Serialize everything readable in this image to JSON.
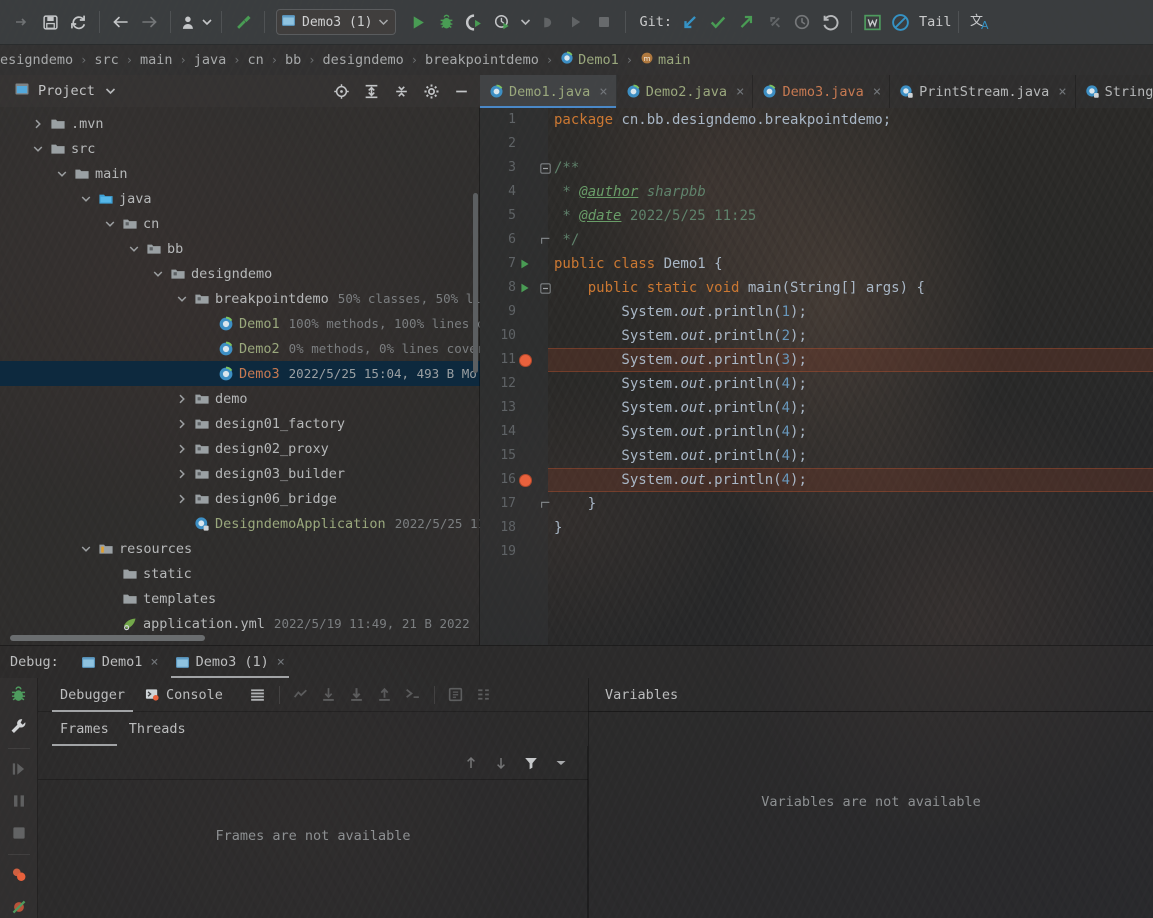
{
  "toolbar": {
    "icons_left": [
      {
        "name": "save-icon",
        "glyph": "save"
      },
      {
        "name": "sync-icon",
        "glyph": "sync"
      },
      {
        "name": "back-arrow-icon",
        "glyph": "back"
      },
      {
        "name": "forward-arrow-icon",
        "glyph": "forward"
      },
      {
        "name": "profile-icon",
        "glyph": "profile"
      },
      {
        "name": "build-hammer-icon",
        "glyph": "hammer"
      }
    ],
    "run_config": {
      "label": "Demo3 (1)",
      "icon": "run-config-icon"
    },
    "run_icons": [
      {
        "name": "run-button",
        "glyph": "run"
      },
      {
        "name": "debug-button",
        "glyph": "debug"
      },
      {
        "name": "run-with-coverage-button",
        "glyph": "coverage"
      },
      {
        "name": "profile-button",
        "glyph": "profiler"
      },
      {
        "name": "more-run-options-button",
        "glyph": "chevron"
      },
      {
        "name": "attach-process-button",
        "glyph": "attach"
      },
      {
        "name": "rerun-button",
        "glyph": "rerun-disabled"
      },
      {
        "name": "stop-button",
        "glyph": "stop"
      }
    ],
    "git_label": "Git:",
    "git_icons": [
      {
        "name": "git-update-project-icon",
        "glyph": "update"
      },
      {
        "name": "git-commit-icon",
        "glyph": "commit"
      },
      {
        "name": "git-push-icon",
        "glyph": "push"
      },
      {
        "name": "git-rollback-icon",
        "glyph": "rollback"
      },
      {
        "name": "git-history-icon",
        "glyph": "history"
      },
      {
        "name": "undo-icon",
        "glyph": "undo"
      }
    ],
    "right_icons": [
      {
        "name": "translate-w-icon",
        "glyph": "wbox"
      },
      {
        "name": "no-entry-icon",
        "glyph": "noentry"
      }
    ],
    "tail_label": "Tail",
    "translate_icon": "translate-icon"
  },
  "breadcrumb": {
    "items": [
      {
        "label": "esigndemo",
        "kind": "plain"
      },
      {
        "label": "src",
        "kind": "plain"
      },
      {
        "label": "main",
        "kind": "plain"
      },
      {
        "label": "java",
        "kind": "plain"
      },
      {
        "label": "cn",
        "kind": "plain"
      },
      {
        "label": "bb",
        "kind": "plain"
      },
      {
        "label": "designdemo",
        "kind": "plain"
      },
      {
        "label": "breakpointdemo",
        "kind": "plain"
      },
      {
        "label": "Demo1",
        "kind": "class"
      },
      {
        "label": "main",
        "kind": "method"
      }
    ],
    "separator": "›"
  },
  "project_panel": {
    "title": "Project",
    "title_icon": "project-view-icon",
    "dropdown_icon": "chevron-down-icon",
    "actions": [
      {
        "name": "locate-file-icon",
        "glyph": "target"
      },
      {
        "name": "expand-all-icon",
        "glyph": "expand"
      },
      {
        "name": "collapse-all-icon",
        "glyph": "collapse"
      },
      {
        "name": "settings-gear-icon",
        "glyph": "gear"
      },
      {
        "name": "hide-panel-icon",
        "glyph": "minus"
      }
    ],
    "tree": [
      {
        "label": ".mvn",
        "indent": 1,
        "twisty": "right",
        "icon": "folder",
        "info": "",
        "selected": false,
        "kind": "plain"
      },
      {
        "label": "src",
        "indent": 1,
        "twisty": "down",
        "icon": "folder",
        "info": "",
        "selected": false,
        "kind": "plain"
      },
      {
        "label": "main",
        "indent": 2,
        "twisty": "down",
        "icon": "folder",
        "info": "",
        "selected": false,
        "kind": "plain"
      },
      {
        "label": "java",
        "indent": 3,
        "twisty": "down",
        "icon": "folder-source",
        "info": "",
        "selected": false,
        "kind": "plain"
      },
      {
        "label": "cn",
        "indent": 4,
        "twisty": "down",
        "icon": "folder-pkg",
        "info": "",
        "selected": false,
        "kind": "plain"
      },
      {
        "label": "bb",
        "indent": 5,
        "twisty": "down",
        "icon": "folder-pkg",
        "info": "",
        "selected": false,
        "kind": "plain"
      },
      {
        "label": "designdemo",
        "indent": 6,
        "twisty": "down",
        "icon": "folder-pkg",
        "info": "",
        "selected": false,
        "kind": "plain"
      },
      {
        "label": "breakpointdemo",
        "indent": 7,
        "twisty": "down",
        "icon": "folder-pkg",
        "info": "50% classes, 50% li",
        "selected": false,
        "kind": "plain"
      },
      {
        "label": "Demo1",
        "indent": 8,
        "twisty": "none",
        "icon": "java-class",
        "info": "100% methods, 100% lines c",
        "selected": false,
        "kind": "green"
      },
      {
        "label": "Demo2",
        "indent": 8,
        "twisty": "none",
        "icon": "java-class",
        "info": "0% methods, 0% lines cover",
        "selected": false,
        "kind": "green"
      },
      {
        "label": "Demo3",
        "indent": 8,
        "twisty": "none",
        "icon": "java-class",
        "info": "2022/5/25 15:04, 493 B Mo",
        "selected": true,
        "kind": "selected"
      },
      {
        "label": "demo",
        "indent": 7,
        "twisty": "right",
        "icon": "folder-pkg",
        "info": "",
        "selected": false,
        "kind": "plain"
      },
      {
        "label": "design01_factory",
        "indent": 7,
        "twisty": "right",
        "icon": "folder-pkg",
        "info": "",
        "selected": false,
        "kind": "plain"
      },
      {
        "label": "design02_proxy",
        "indent": 7,
        "twisty": "right",
        "icon": "folder-pkg",
        "info": "",
        "selected": false,
        "kind": "plain"
      },
      {
        "label": "design03_builder",
        "indent": 7,
        "twisty": "right",
        "icon": "folder-pkg",
        "info": "",
        "selected": false,
        "kind": "plain"
      },
      {
        "label": "design06_bridge",
        "indent": 7,
        "twisty": "right",
        "icon": "folder-pkg",
        "info": "",
        "selected": false,
        "kind": "plain"
      },
      {
        "label": "DesigndemoApplication",
        "indent": 7,
        "twisty": "none",
        "icon": "spring-class",
        "info": "2022/5/25 11",
        "selected": false,
        "kind": "green"
      },
      {
        "label": "resources",
        "indent": 3,
        "twisty": "down",
        "icon": "folder-resources",
        "info": "",
        "selected": false,
        "kind": "plain"
      },
      {
        "label": "static",
        "indent": 4,
        "twisty": "none",
        "icon": "folder",
        "info": "",
        "selected": false,
        "kind": "plain"
      },
      {
        "label": "templates",
        "indent": 4,
        "twisty": "none",
        "icon": "folder",
        "info": "",
        "selected": false,
        "kind": "plain"
      },
      {
        "label": "application.yml",
        "indent": 4,
        "twisty": "none",
        "icon": "yml-file",
        "info": "2022/5/19 11:49, 21 B 2022",
        "selected": false,
        "kind": "plain"
      }
    ]
  },
  "editor_tabs": [
    {
      "label": "Demo1.java",
      "icon": "java-class-icon",
      "color": "#9aa87d",
      "active": true,
      "close": "×"
    },
    {
      "label": "Demo2.java",
      "icon": "java-class-icon",
      "color": "#9aa87d",
      "active": false,
      "close": "×"
    },
    {
      "label": "Demo3.java",
      "icon": "java-class-icon",
      "color": "#c77a52",
      "active": false,
      "close": "×"
    },
    {
      "label": "PrintStream.java",
      "icon": "java-class-readonly-icon",
      "color": "#b6b8b9",
      "active": false,
      "close": "×"
    },
    {
      "label": "String",
      "icon": "java-class-readonly-icon",
      "color": "#b6b8b9",
      "active": false,
      "close": ""
    }
  ],
  "editor": {
    "file": "Demo1.java",
    "lines": [
      {
        "n": 1,
        "mark": "none",
        "fold": "none",
        "bp": false,
        "tokens": [
          {
            "t": "package ",
            "c": "kw"
          },
          {
            "t": "cn.bb.designdemo.breakpointdemo;",
            "c": "txt"
          }
        ],
        "indent": 0
      },
      {
        "n": 2,
        "mark": "none",
        "fold": "none",
        "bp": false,
        "tokens": [],
        "indent": 0
      },
      {
        "n": 3,
        "mark": "none",
        "fold": "minus",
        "bp": false,
        "tokens": [
          {
            "t": "/**",
            "c": "cmt"
          }
        ],
        "indent": 0
      },
      {
        "n": 4,
        "mark": "none",
        "fold": "none",
        "bp": false,
        "tokens": [
          {
            "t": " * ",
            "c": "cmt"
          },
          {
            "t": "@author",
            "c": "tag"
          },
          {
            "t": " sharpbb",
            "c": "cmt-i"
          }
        ],
        "indent": 0
      },
      {
        "n": 5,
        "mark": "none",
        "fold": "none",
        "bp": false,
        "tokens": [
          {
            "t": " * ",
            "c": "cmt"
          },
          {
            "t": "@date",
            "c": "tag"
          },
          {
            "t": " 2022/5/25 11:25",
            "c": "cmt"
          }
        ],
        "indent": 0
      },
      {
        "n": 6,
        "mark": "none",
        "fold": "end",
        "bp": false,
        "tokens": [
          {
            "t": " */",
            "c": "cmt"
          }
        ],
        "indent": 0
      },
      {
        "n": 7,
        "mark": "run",
        "fold": "none",
        "bp": false,
        "tokens": [
          {
            "t": "public class ",
            "c": "kw"
          },
          {
            "t": "Demo1 {",
            "c": "cls"
          }
        ],
        "indent": 0
      },
      {
        "n": 8,
        "mark": "run",
        "fold": "minus",
        "bp": false,
        "tokens": [
          {
            "t": "    public static void ",
            "c": "kw"
          },
          {
            "t": "main(String[] args) {",
            "c": "cls"
          }
        ],
        "indent": 0
      },
      {
        "n": 9,
        "mark": "none",
        "fold": "none",
        "bp": false,
        "tokens": [
          {
            "t": "        System.",
            "c": "txt"
          },
          {
            "t": "out",
            "c": "fld"
          },
          {
            "t": ".println(",
            "c": "txt"
          },
          {
            "t": "1",
            "c": "num"
          },
          {
            "t": ");",
            "c": "txt"
          }
        ],
        "indent": 0
      },
      {
        "n": 10,
        "mark": "none",
        "fold": "none",
        "bp": false,
        "tokens": [
          {
            "t": "        System.",
            "c": "txt"
          },
          {
            "t": "out",
            "c": "fld"
          },
          {
            "t": ".println(",
            "c": "txt"
          },
          {
            "t": "2",
            "c": "num"
          },
          {
            "t": ");",
            "c": "txt"
          }
        ],
        "indent": 0
      },
      {
        "n": 11,
        "mark": "breakpoint",
        "fold": "none",
        "bp": true,
        "tokens": [
          {
            "t": "        System.",
            "c": "txt"
          },
          {
            "t": "out",
            "c": "fld"
          },
          {
            "t": ".println(",
            "c": "txt"
          },
          {
            "t": "3",
            "c": "num"
          },
          {
            "t": ");",
            "c": "txt"
          }
        ],
        "indent": 0
      },
      {
        "n": 12,
        "mark": "none",
        "fold": "none",
        "bp": false,
        "tokens": [
          {
            "t": "        System.",
            "c": "txt"
          },
          {
            "t": "out",
            "c": "fld"
          },
          {
            "t": ".println(",
            "c": "txt"
          },
          {
            "t": "4",
            "c": "num"
          },
          {
            "t": ");",
            "c": "txt"
          }
        ],
        "indent": 0
      },
      {
        "n": 13,
        "mark": "none",
        "fold": "none",
        "bp": false,
        "tokens": [
          {
            "t": "        System.",
            "c": "txt"
          },
          {
            "t": "out",
            "c": "fld"
          },
          {
            "t": ".println(",
            "c": "txt"
          },
          {
            "t": "4",
            "c": "num"
          },
          {
            "t": ");",
            "c": "txt"
          }
        ],
        "indent": 0
      },
      {
        "n": 14,
        "mark": "none",
        "fold": "none",
        "bp": false,
        "tokens": [
          {
            "t": "        System.",
            "c": "txt"
          },
          {
            "t": "out",
            "c": "fld"
          },
          {
            "t": ".println(",
            "c": "txt"
          },
          {
            "t": "4",
            "c": "num"
          },
          {
            "t": ");",
            "c": "txt"
          }
        ],
        "indent": 0
      },
      {
        "n": 15,
        "mark": "none",
        "fold": "none",
        "bp": false,
        "tokens": [
          {
            "t": "        System.",
            "c": "txt"
          },
          {
            "t": "out",
            "c": "fld"
          },
          {
            "t": ".println(",
            "c": "txt"
          },
          {
            "t": "4",
            "c": "num"
          },
          {
            "t": ");",
            "c": "txt"
          }
        ],
        "indent": 0
      },
      {
        "n": 16,
        "mark": "breakpoint",
        "fold": "none",
        "bp": true,
        "tokens": [
          {
            "t": "        System.",
            "c": "txt"
          },
          {
            "t": "out",
            "c": "fld"
          },
          {
            "t": ".println(",
            "c": "txt"
          },
          {
            "t": "4",
            "c": "num"
          },
          {
            "t": ");",
            "c": "txt"
          }
        ],
        "indent": 0
      },
      {
        "n": 17,
        "mark": "none",
        "fold": "end",
        "bp": false,
        "tokens": [
          {
            "t": "    }",
            "c": "txt"
          }
        ],
        "indent": 0
      },
      {
        "n": 18,
        "mark": "none",
        "fold": "none",
        "bp": false,
        "tokens": [
          {
            "t": "}",
            "c": "txt"
          }
        ],
        "indent": 0
      },
      {
        "n": 19,
        "mark": "none",
        "fold": "none",
        "bp": false,
        "tokens": [],
        "indent": 0
      }
    ]
  },
  "debug": {
    "label": "Debug:",
    "sessions": [
      {
        "label": "Demo1",
        "active": false,
        "close": "×",
        "icon": "session-icon"
      },
      {
        "label": "Demo3 (1)",
        "active": true,
        "close": "×",
        "icon": "session-icon"
      }
    ],
    "rail": [
      {
        "name": "debugger-bug-icon",
        "glyph": "bug"
      },
      {
        "name": "settings-wrench-icon",
        "glyph": "wrench"
      },
      {
        "name": "resume-program-icon",
        "glyph": "resume"
      },
      {
        "name": "pause-program-icon",
        "glyph": "pause"
      },
      {
        "name": "stop-program-icon",
        "glyph": "stop"
      },
      {
        "name": "view-breakpoints-icon",
        "glyph": "breakpoints"
      },
      {
        "name": "mute-breakpoints-icon",
        "glyph": "mute"
      }
    ],
    "subtabs": [
      {
        "label": "Debugger",
        "active": true,
        "icon": ""
      },
      {
        "label": "Console",
        "active": false,
        "icon": "console-icon"
      }
    ],
    "toolbar_icons": [
      {
        "name": "layout-settings-icon",
        "glyph": "layout"
      },
      {
        "name": "show-execution-point-icon",
        "glyph": "exec-point"
      },
      {
        "name": "step-over-icon",
        "glyph": "step-over"
      },
      {
        "name": "step-into-icon",
        "glyph": "step-into"
      },
      {
        "name": "step-out-icon",
        "glyph": "step-out"
      },
      {
        "name": "run-to-cursor-icon",
        "glyph": "run-to-cursor"
      },
      {
        "name": "evaluate-expression-icon",
        "glyph": "evaluate"
      },
      {
        "name": "trace-icon",
        "glyph": "trace"
      }
    ],
    "frames_tabs": [
      {
        "label": "Frames",
        "active": true
      },
      {
        "label": "Threads",
        "active": false
      }
    ],
    "frames_toolbar_icons": [
      {
        "name": "move-up-icon",
        "glyph": "arrow-up"
      },
      {
        "name": "move-down-icon",
        "glyph": "arrow-down"
      },
      {
        "name": "filter-icon",
        "glyph": "funnel"
      },
      {
        "name": "filter-options-icon",
        "glyph": "chevron-down"
      }
    ],
    "frames_empty_text": "Frames are not available",
    "variables_title": "Variables",
    "variables_empty_text": "Variables are not available"
  },
  "colors": {
    "accent_blue": "#4a88c7",
    "selection_blue": "#0d293e",
    "breakpoint_red": "#e8613c",
    "keyword_orange": "#cc7832",
    "comment_green": "#5f826b",
    "number_blue": "#6897bb",
    "text_grey": "#a9b7c6",
    "run_green": "#499c54"
  }
}
